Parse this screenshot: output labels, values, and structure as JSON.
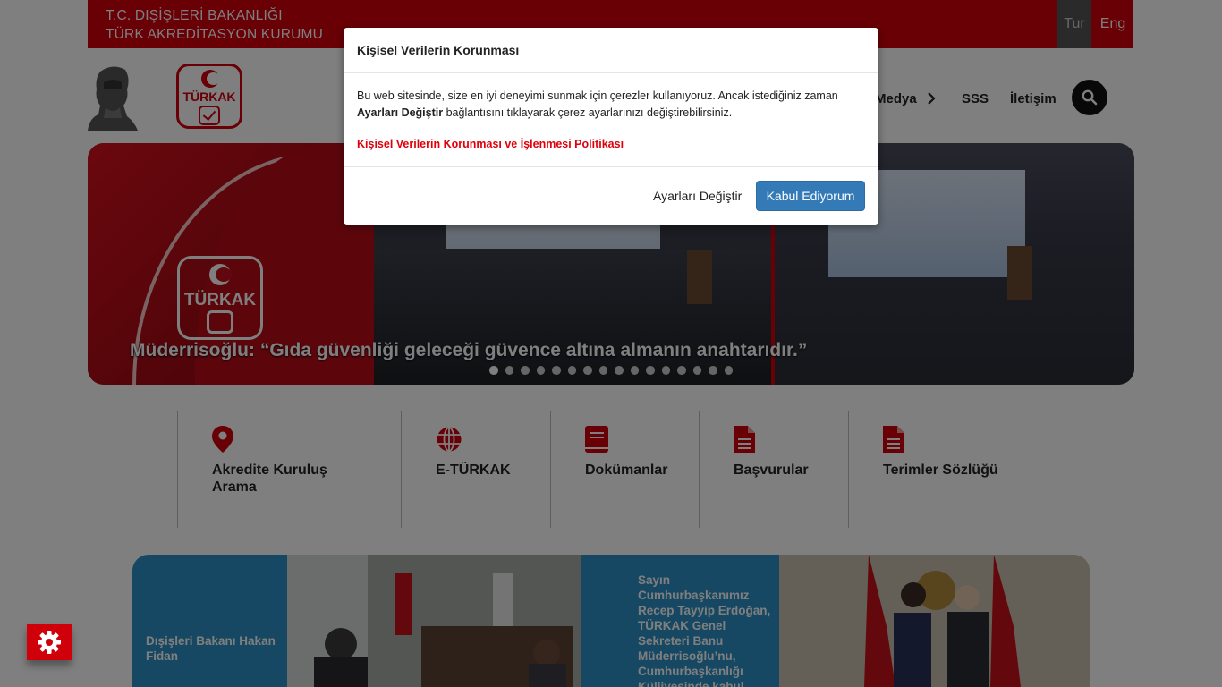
{
  "topbar": {
    "org_line1": "T.C. DIŞİŞLERİ BAKANLIĞI",
    "org_line2": "TÜRK AKREDİTASYON KURUMU",
    "lang_tur": "Tur",
    "lang_eng": "Eng"
  },
  "header": {
    "logo_text": "TÜRKAK",
    "nav": {
      "medya": "Medya",
      "sss": "SSS",
      "iletisim": "İletişim"
    }
  },
  "slider": {
    "logo_text": "TÜRKAK",
    "caption": "Müderrisoğlu: “Gıda güvenliği geleceği güvence altına almanın anahtarıdır.”",
    "slide_count": 16,
    "active_index": 0
  },
  "quick_links": [
    {
      "label_line1": "Akredite Kuruluş",
      "label_line2": "Arama",
      "icon": "map-pin-icon"
    },
    {
      "label_line1": "E-TÜRKAK",
      "label_line2": "",
      "icon": "globe-icon"
    },
    {
      "label_line1": "Dokümanlar",
      "label_line2": "",
      "icon": "book-icon"
    },
    {
      "label_line1": "Başvurular",
      "label_line2": "",
      "icon": "document-icon"
    },
    {
      "label_line1": "Terimler Sözlüğü",
      "label_line2": "",
      "icon": "document-icon"
    }
  ],
  "news": {
    "tile1": "Dışişleri Bakanı Hakan Fidan",
    "tile2": "Sayın Cumhurbaşkanımız Recep Tayyip Erdoğan, TÜRKAK Genel Sekreteri Banu Müderrisoğlu’nu, Cumhurbaşkanlığı Külliyesinde kabul"
  },
  "modal": {
    "title": "Kişisel Verilerin Korunması",
    "body_part1": "Bu web sitesinde, size en iyi deneyimi sunmak için çerezler kullanıyoruz. Ancak istediğiniz zaman ",
    "body_bold": "Ayarları Değiştir",
    "body_part2": " bağlantısını tıklayarak çerez ayarlarınızı değiştirebilirsiniz.",
    "policy_link": "Kişisel Verilerin Korunması ve İşlenmesi Politikası",
    "settings_button": "Ayarları Değiştir",
    "accept_button": "Kabul Ediyorum"
  },
  "colors": {
    "brand_red": "#d0000b",
    "accept_blue": "#337ab7",
    "tile_blue": "#2c91c6"
  }
}
